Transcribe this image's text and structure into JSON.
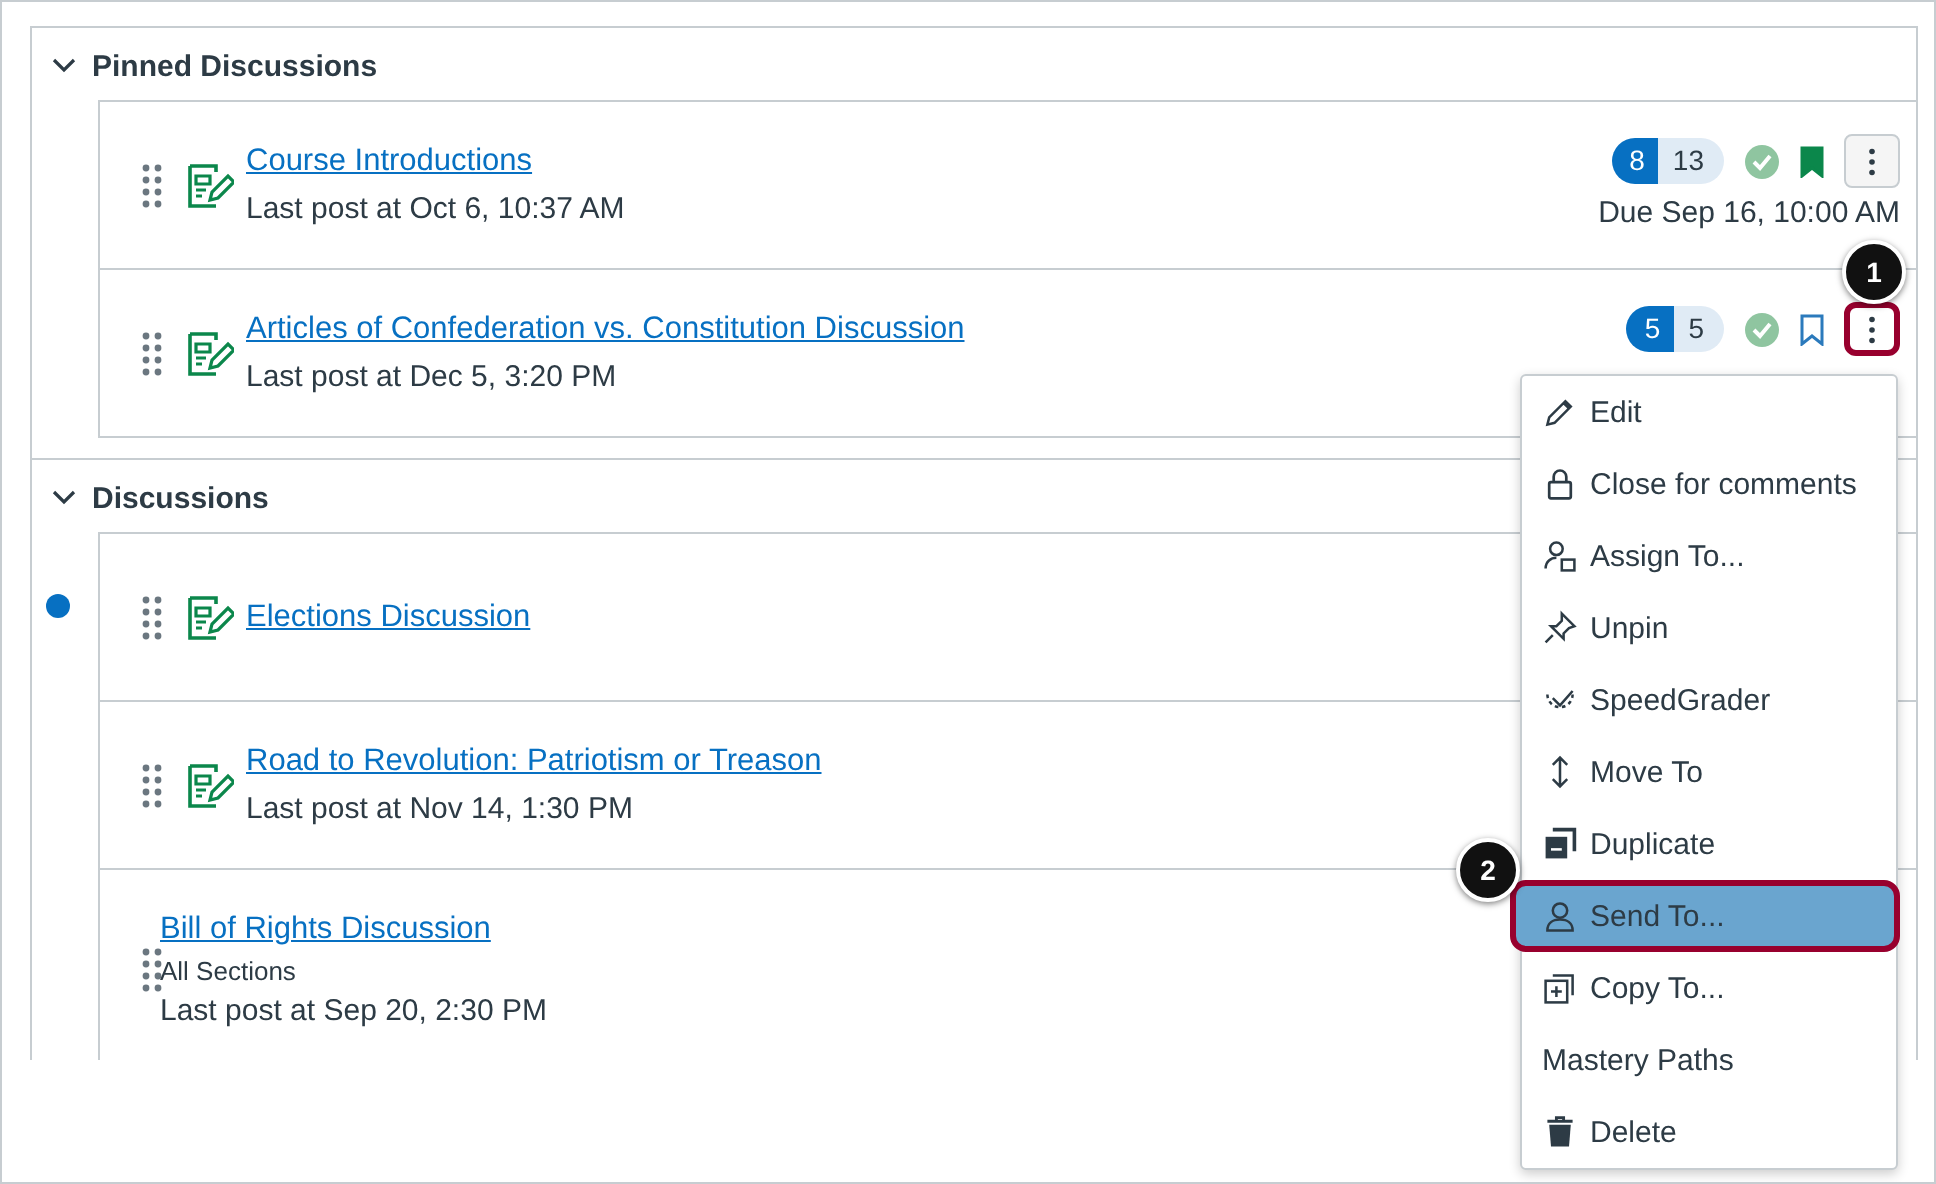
{
  "sections": [
    {
      "title": "Pinned Discussions",
      "expanded": true,
      "items": [
        {
          "title": "Course Introductions",
          "unread": false,
          "has_icon": true,
          "last_post": "Last post at Oct 6, 10:37 AM",
          "status": {
            "replies_unread": "8",
            "replies_total": "13",
            "published": true,
            "bookmarked": true,
            "menu_highlight": false,
            "due": "Due Sep 16, 10:00 AM"
          }
        },
        {
          "title": "Articles of Confederation vs. Constitution Discussion",
          "unread": false,
          "has_icon": true,
          "last_post": "Last post at Dec 5, 3:20 PM",
          "status": {
            "replies_unread": "5",
            "replies_total": "5",
            "published": true,
            "bookmarked": false,
            "menu_highlight": true
          }
        }
      ]
    },
    {
      "title": "Discussions",
      "expanded": true,
      "items": [
        {
          "title": "Elections Discussion",
          "unread": true,
          "has_icon": true
        },
        {
          "title": "Road to Revolution: Patriotism or Treason",
          "unread": false,
          "has_icon": true,
          "last_post": "Last post at Nov 14, 1:30 PM"
        },
        {
          "title": "Bill of Rights Discussion",
          "unread": false,
          "has_icon": false,
          "subtitle": "All Sections",
          "last_post": "Last post at Sep 20, 2:30 PM"
        }
      ]
    }
  ],
  "menu": {
    "items": [
      {
        "label": "Edit",
        "selected": false
      },
      {
        "label": "Close for comments",
        "selected": false
      },
      {
        "label": "Assign To...",
        "selected": false
      },
      {
        "label": "Unpin",
        "selected": false
      },
      {
        "label": "SpeedGrader",
        "selected": false
      },
      {
        "label": "Move To",
        "selected": false
      },
      {
        "label": "Duplicate",
        "selected": false
      },
      {
        "label": "Send To...",
        "selected": true
      },
      {
        "label": "Copy To...",
        "selected": false
      },
      {
        "label": "Mastery Paths",
        "selected": false
      },
      {
        "label": "Delete",
        "selected": false
      }
    ]
  },
  "callouts": [
    "1",
    "2"
  ]
}
